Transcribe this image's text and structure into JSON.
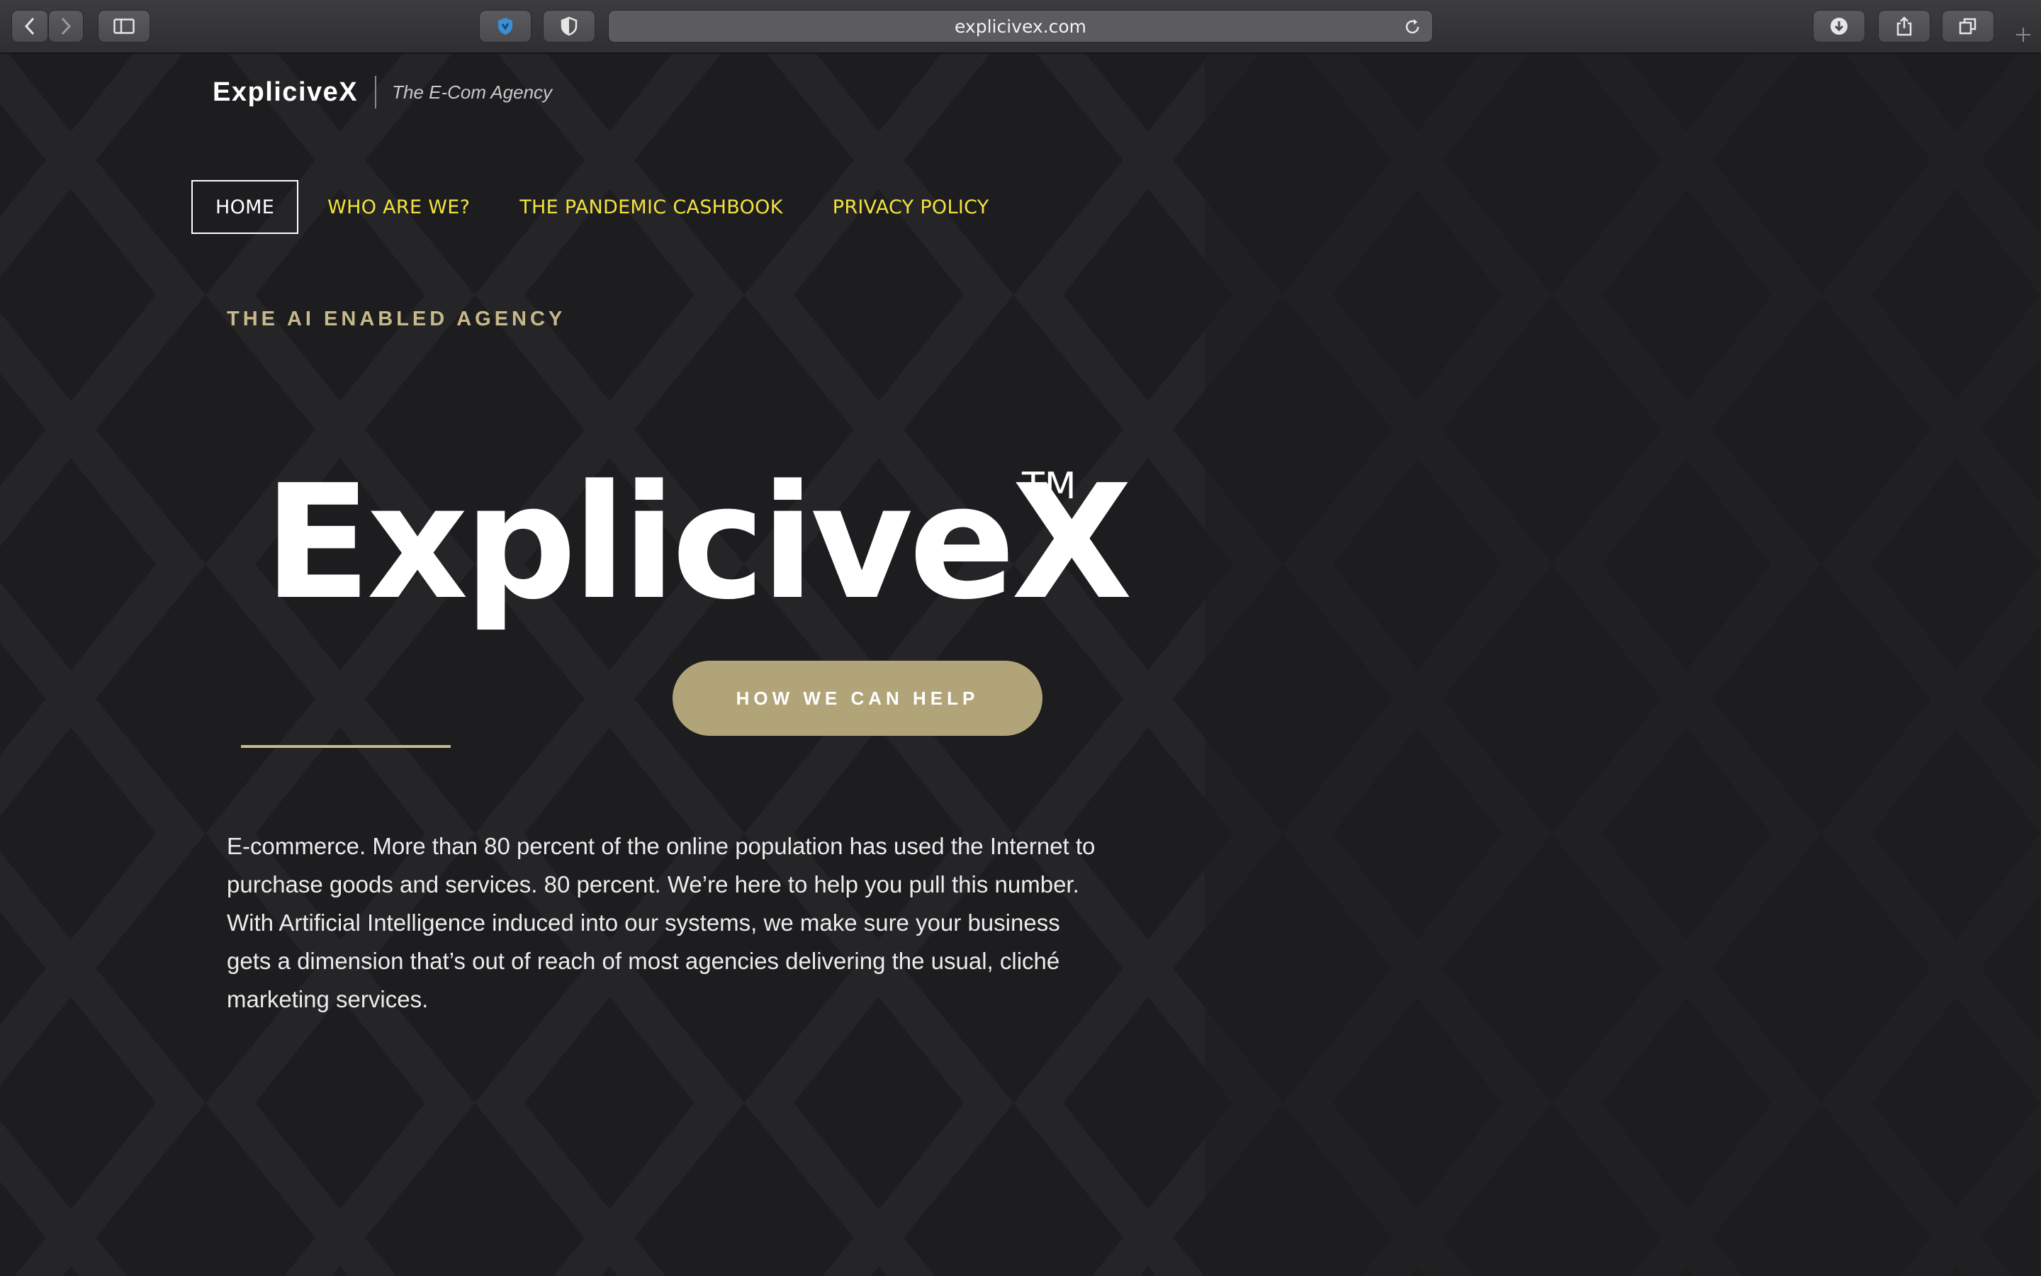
{
  "browser": {
    "url": "explicivex.com",
    "icons": [
      "back-icon",
      "forward-icon",
      "sidebar-icon",
      "extension-shield-icon",
      "privacy-shield-icon",
      "reload-icon",
      "download-icon",
      "share-icon",
      "tabs-icon",
      "new-tab-icon"
    ]
  },
  "site": {
    "name": "ExplicivеX",
    "tagline": "The E-Com Agency"
  },
  "nav": {
    "items": [
      {
        "label": "HOME",
        "active": true
      },
      {
        "label": "WHO ARE WE?",
        "active": false
      },
      {
        "label": "THE PANDEMIC CASHBOOK",
        "active": false
      },
      {
        "label": "PRIVACY POLICY",
        "active": false
      }
    ]
  },
  "hero": {
    "eyebrow": "THE AI ENABLED AGENCY",
    "logo_text": "ExplicivеX",
    "logo_tm": "TM",
    "cta_label": "HOW WE CAN HELP",
    "body": "E-commerce. More than 80 percent of the online population has used the Internet to purchase goods and services. 80 percent. We’re here to help you pull this number. With Artificial Intelligence induced into our systems, we make sure your business gets a dimension that’s out of reach of most agencies delivering the usual, cliché marketing services."
  },
  "colors": {
    "background": "#1d1d1f",
    "accent_gold": "#b1a478",
    "nav_yellow": "#f3e23d",
    "pattern": "#262628"
  }
}
